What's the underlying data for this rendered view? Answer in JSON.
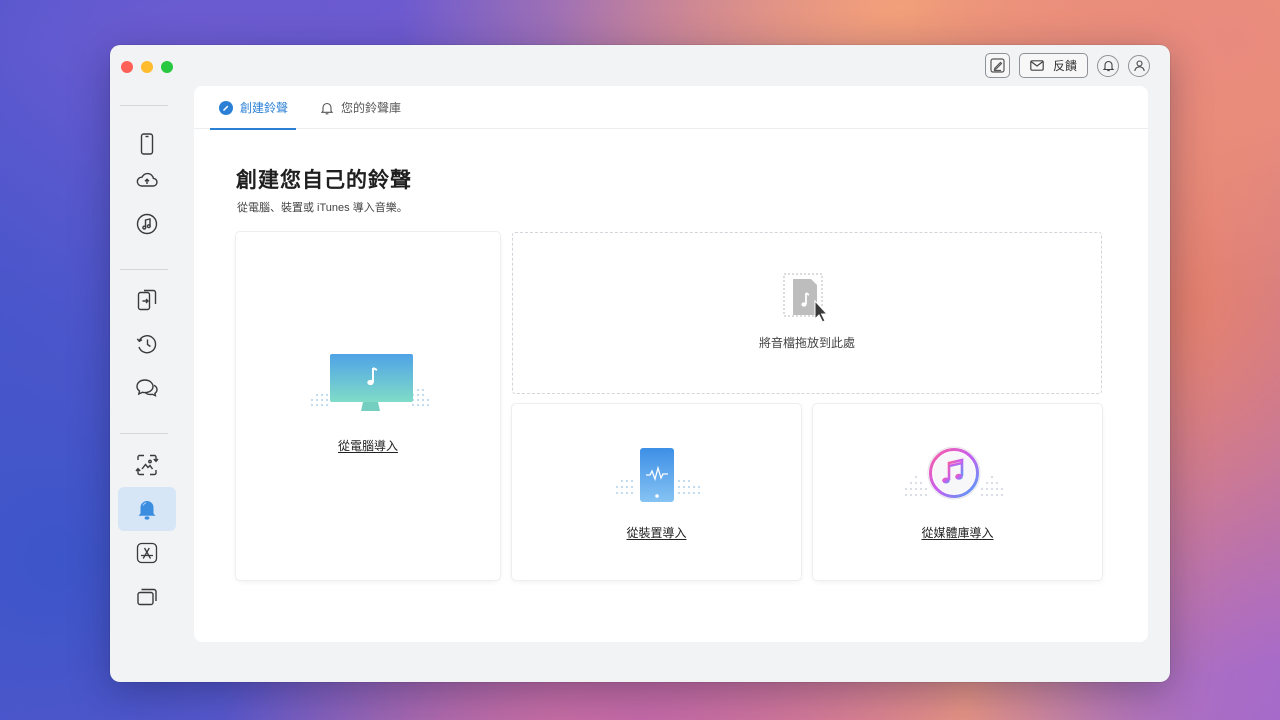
{
  "window": {
    "top_actions": {
      "edit_icon": "edit-icon",
      "feedback_label": "反饋",
      "bell_icon": "bell-icon",
      "user_icon": "user-icon"
    }
  },
  "sidebar": {
    "items": [
      {
        "name": "device",
        "icon": "phone-icon",
        "active": false
      },
      {
        "name": "icloud",
        "icon": "cloud-icon",
        "active": false
      },
      {
        "name": "music",
        "icon": "music-disc-icon",
        "active": false
      },
      {
        "name": "transfer",
        "icon": "phone-transfer-icon",
        "active": false
      },
      {
        "name": "history",
        "icon": "history-icon",
        "active": false
      },
      {
        "name": "messages",
        "icon": "chat-icon",
        "active": false
      },
      {
        "name": "photo-convert",
        "icon": "photo-sync-icon",
        "active": false
      },
      {
        "name": "ringtone",
        "icon": "bell-icon",
        "active": true
      },
      {
        "name": "app-store",
        "icon": "app-store-icon",
        "active": false
      },
      {
        "name": "windows",
        "icon": "stack-icon",
        "active": false
      }
    ],
    "expand_icon": "chevron-right-icon"
  },
  "tabs": [
    {
      "label": "創建鈴聲",
      "active": true
    },
    {
      "label": "您的鈴聲庫",
      "active": false
    }
  ],
  "main": {
    "title": "創建您自己的鈴聲",
    "subtitle": "從電腦、裝置或 iTunes 導入音樂。",
    "cards": {
      "computer": "從電腦導入",
      "drop_zone": "將音檔拖放到此處",
      "device": "從裝置導入",
      "media_library": "從媒體庫導入"
    }
  },
  "colors": {
    "accent": "#2b80d6",
    "active_sidebar_bg": "#d6e6f7"
  }
}
